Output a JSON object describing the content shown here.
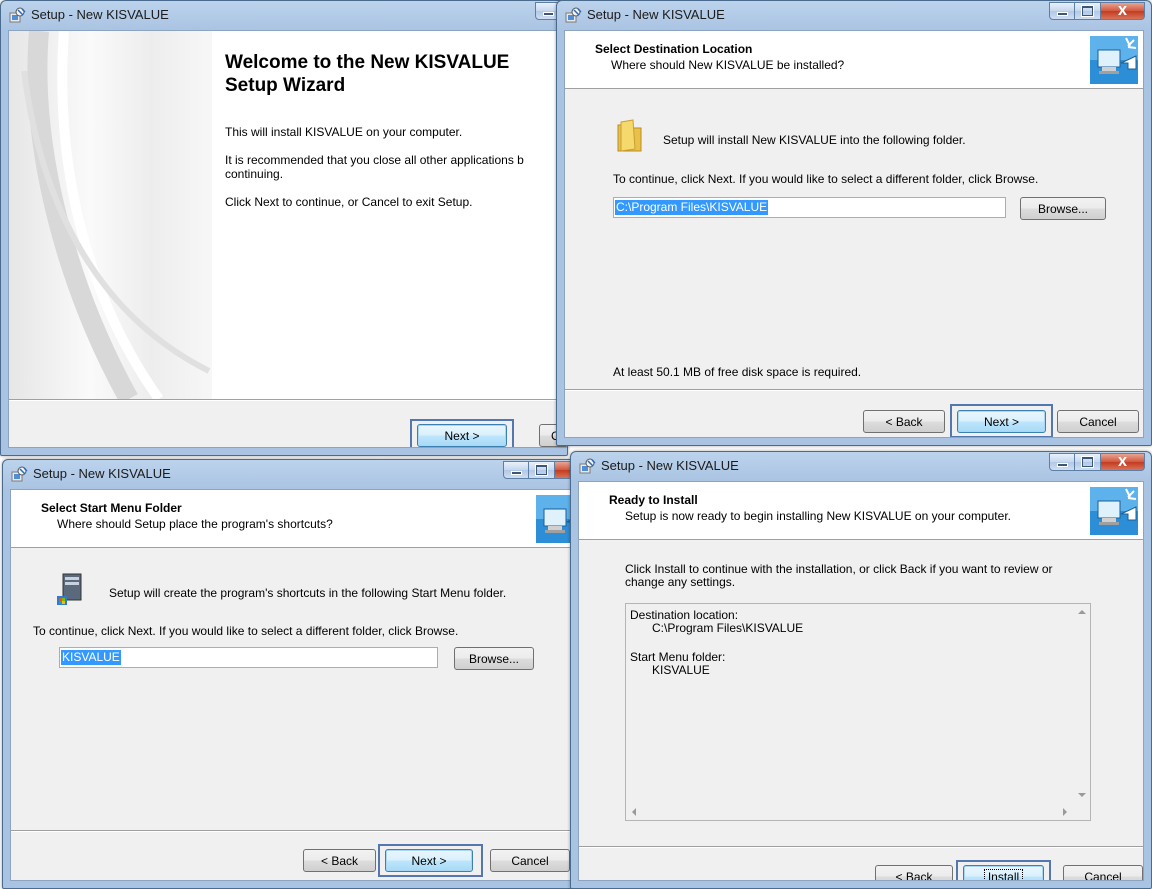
{
  "windows": {
    "welcome": {
      "title": "Setup - New KISVALUE",
      "heading": "Welcome to the New KISVALUE Setup Wizard",
      "para1": "This will install KISVALUE on your computer.",
      "para2_line1": "It is recommended that you close all other applications b",
      "para2_line2": "continuing.",
      "para3": "Click Next to continue, or Cancel to exit Setup.",
      "next_label": "Next >",
      "cancel_label": "C"
    },
    "destination": {
      "title": "Setup - New KISVALUE",
      "header_title": "Select Destination Location",
      "header_subtitle": "Where should New KISVALUE be installed?",
      "info": "Setup will install New KISVALUE into the following folder.",
      "instruction": "To continue, click Next. If you would like to select a different folder, click Browse.",
      "path_value": "C:\\Program Files\\KISVALUE",
      "browse_label": "Browse...",
      "disk_space": "At least 50.1 MB of free disk space is required.",
      "back_label": "< Back",
      "next_label": "Next >",
      "cancel_label": "Cancel"
    },
    "startmenu": {
      "title": "Setup - New KISVALUE",
      "header_title": "Select Start Menu Folder",
      "header_subtitle": "Where should Setup place the program's shortcuts?",
      "info": "Setup will create the program's shortcuts in the following Start Menu folder.",
      "instruction": "To continue, click Next. If you would like to select a different folder, click Browse.",
      "folder_value": "KISVALUE",
      "browse_label": "Browse...",
      "back_label": "< Back",
      "next_label": "Next >",
      "cancel_label": "Cancel"
    },
    "ready": {
      "title": "Setup - New KISVALUE",
      "header_title": "Ready to Install",
      "header_subtitle": "Setup is now ready to begin installing New KISVALUE on your computer.",
      "intro_line1": "Click Install to continue with the installation, or click Back if you want to review or",
      "intro_line2": "change any settings.",
      "memo_dest_label": "Destination location:",
      "memo_dest_value": "C:\\Program Files\\KISVALUE",
      "memo_start_label": "Start Menu folder:",
      "memo_start_value": "KISVALUE",
      "back_label": "< Back",
      "install_label": "Install",
      "cancel_label": "Cancel"
    }
  },
  "icons": {
    "app": "setup-app-icon",
    "wizard": "computer-install-icon",
    "folder": "folder-icon",
    "shortcuts": "start-menu-icon",
    "minimize": "minimize-icon",
    "maximize": "maximize-icon",
    "close": "close-icon",
    "close_glyph": "X"
  },
  "colors": {
    "selection": "#3399ff",
    "focus_ring": "#5577b0",
    "close_button": "#c23c1f",
    "title_bar": "#a9c3e2"
  }
}
